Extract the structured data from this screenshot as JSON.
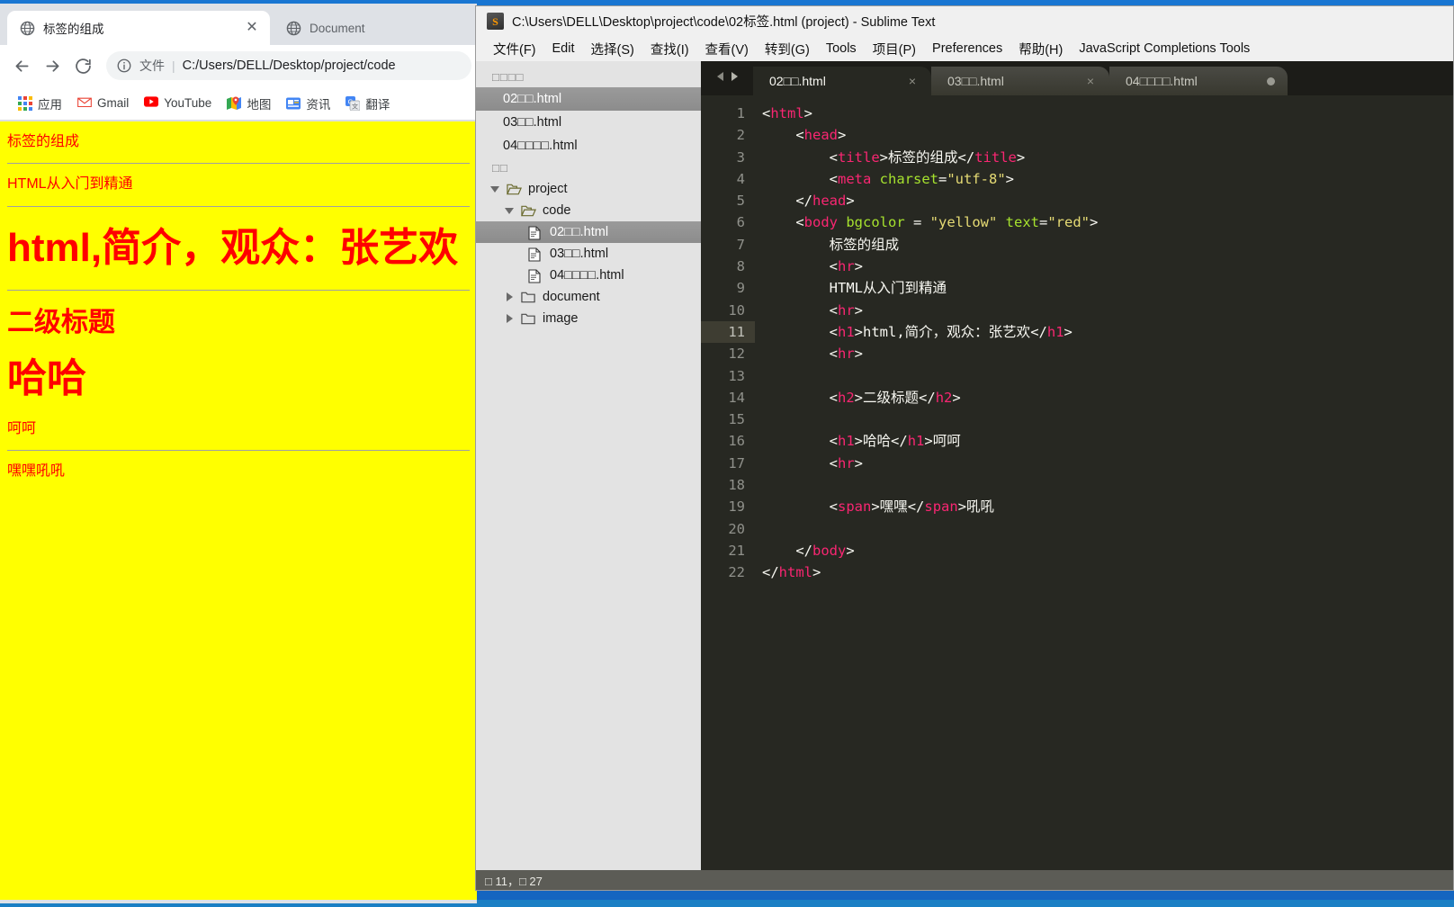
{
  "browser": {
    "tabs": [
      {
        "title": "标签的组成",
        "favicon": "globe-icon",
        "active": true,
        "close": "✕"
      },
      {
        "title": "Document",
        "favicon": "globe-icon",
        "active": false,
        "close": ""
      }
    ],
    "toolbar": {
      "back_icon": "back-arrow-icon",
      "forward_icon": "forward-arrow-icon",
      "reload_icon": "reload-icon"
    },
    "omnibox": {
      "info_icon": "info-circle-icon",
      "scheme_label": "文件",
      "separator": "|",
      "url": "C:/Users/DELL/Desktop/project/code"
    },
    "bookmarks": [
      {
        "label": "应用",
        "icon": "apps-grid-icon"
      },
      {
        "label": "Gmail",
        "icon": "gmail-icon"
      },
      {
        "label": "YouTube",
        "icon": "youtube-icon"
      },
      {
        "label": "地图",
        "icon": "maps-icon"
      },
      {
        "label": "资讯",
        "icon": "news-icon"
      },
      {
        "label": "翻译",
        "icon": "translate-icon"
      }
    ],
    "page": {
      "bgcolor": "#ffff00",
      "textcolor": "#ff0000",
      "line1": "标签的组成",
      "line2": "HTML从入门到精通",
      "h1_a": "html,简介，观众：张艺欢",
      "h2_a": "二级标题",
      "h1_b": "哈哈",
      "after_h1_b": "呵呵",
      "span_line": "嘿嘿吼吼"
    }
  },
  "sublime": {
    "title": "C:\\Users\\DELL\\Desktop\\project\\code\\02标签.html (project) - Sublime Text",
    "app_icon": "sublime-text-icon",
    "menu": [
      {
        "label": "文件(F)",
        "mnemonic": "F"
      },
      {
        "label": "Edit",
        "mnemonic": "E"
      },
      {
        "label": "选择(S)",
        "mnemonic": "S"
      },
      {
        "label": "查找(I)",
        "mnemonic": "I"
      },
      {
        "label": "查看(V)",
        "mnemonic": "V"
      },
      {
        "label": "转到(G)",
        "mnemonic": "G"
      },
      {
        "label": "Tools",
        "mnemonic": "T"
      },
      {
        "label": "项目(P)",
        "mnemonic": "P"
      },
      {
        "label": "Preferences",
        "mnemonic": "n"
      },
      {
        "label": "帮助(H)",
        "mnemonic": "H"
      },
      {
        "label": "JavaScript Completions Tools",
        "mnemonic": "J"
      }
    ],
    "sidebar": {
      "open_files_header": "□□□□",
      "open_files": [
        {
          "name": "02□□.html",
          "selected": true
        },
        {
          "name": "03□□.html",
          "selected": false
        },
        {
          "name": "04□□□□.html",
          "selected": false
        }
      ],
      "folders_header": "□□",
      "tree": [
        {
          "label": "project",
          "type": "folder-open",
          "depth": 0,
          "arrow": "down",
          "selected": false
        },
        {
          "label": "code",
          "type": "folder-open",
          "depth": 1,
          "arrow": "down",
          "selected": false
        },
        {
          "label": "02□□.html",
          "type": "file",
          "depth": 2,
          "arrow": "none",
          "selected": true
        },
        {
          "label": "03□□.html",
          "type": "file",
          "depth": 2,
          "arrow": "none",
          "selected": false
        },
        {
          "label": "04□□□□.html",
          "type": "file",
          "depth": 2,
          "arrow": "none",
          "selected": false
        },
        {
          "label": "document",
          "type": "folder",
          "depth": 1,
          "arrow": "right",
          "selected": false
        },
        {
          "label": "image",
          "type": "folder",
          "depth": 1,
          "arrow": "right",
          "selected": false
        }
      ]
    },
    "tabs": [
      {
        "label": "02□□.html",
        "active": true,
        "close": "×",
        "dirty": false
      },
      {
        "label": "03□□.html",
        "active": false,
        "close": "×",
        "dirty": false
      },
      {
        "label": "04□□□□.html",
        "active": false,
        "close": "",
        "dirty": true
      }
    ],
    "editor": {
      "cursor_line": 11,
      "line_numbers": [
        1,
        2,
        3,
        4,
        5,
        6,
        7,
        8,
        9,
        10,
        11,
        12,
        13,
        14,
        15,
        16,
        17,
        18,
        19,
        20,
        21,
        22
      ],
      "lines": [
        "<html>",
        "    <head>",
        "        <title>标签的组成</title>",
        "        <meta charset=\"utf-8\">",
        "    </head>",
        "    <body bgcolor = \"yellow\" text=\"red\">",
        "        标签的组成",
        "        <hr>",
        "        HTML从入门到精通",
        "        <hr>",
        "        <h1>html,简介，观众：张艺欢</h1>",
        "        <hr>",
        "",
        "        <h2>二级标题</h2>",
        "",
        "        <h1>哈哈</h1>呵呵",
        "        <hr>",
        "",
        "        <span>嘿嘿</span>吼吼",
        "",
        "    </body>",
        "</html>"
      ]
    },
    "statusbar": {
      "text": "□ 11，□ 27"
    }
  },
  "colors": {
    "page_bg": "#ffff00",
    "page_text": "#ff0000",
    "editor_bg": "#272822",
    "tag_pink": "#f92672",
    "attr_green": "#a6e22e",
    "string_yellow": "#e6db74",
    "plain_fg": "#f8f8f2",
    "gutter_fg": "#90918b",
    "sidebar_bg": "#e3e3e3",
    "taskbar_blue": "#1976d2"
  }
}
